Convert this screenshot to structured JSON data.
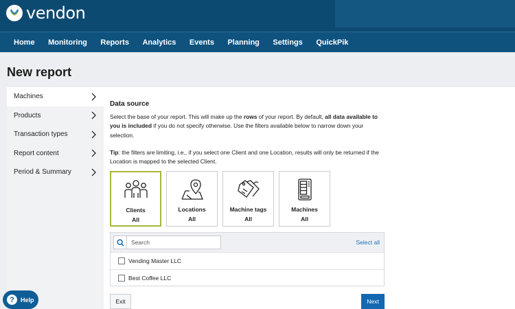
{
  "brand": {
    "name_prefix": "vend",
    "name_suffix": "on",
    "accent": "#a6b73a",
    "header_color": "#0d4a72"
  },
  "nav": {
    "items": [
      "Home",
      "Monitoring",
      "Reports",
      "Analytics",
      "Events",
      "Planning",
      "Settings",
      "QuickPik"
    ]
  },
  "page": {
    "title": "New report"
  },
  "sidebar": {
    "items": [
      {
        "label": "Machines",
        "active": true
      },
      {
        "label": "Products"
      },
      {
        "label": "Transaction types"
      },
      {
        "label": "Report content"
      },
      {
        "label": "Period & Summary"
      }
    ]
  },
  "data_source": {
    "title": "Data source",
    "desc_1": "Select the base of your report. This will make up the ",
    "desc_rows": "rows",
    "desc_2": " of your report. By default, ",
    "desc_bold": "all data available to you is included",
    "desc_3": " if you do not specify otherwise. Use the filters available below to narrow down your selection.",
    "tip_label": "Tip",
    "tip_text": ": the filters are limiting, i.e., if you select one Client and one Location, results will only be returned if the Location is mapped to the selected Client."
  },
  "cards": [
    {
      "name": "Clients",
      "value": "All",
      "icon": "clients-icon",
      "selected": true
    },
    {
      "name": "Locations",
      "value": "All",
      "icon": "location-pin-icon"
    },
    {
      "name": "Machine tags",
      "value": "All",
      "icon": "tags-icon"
    },
    {
      "name": "Machines",
      "value": "All",
      "icon": "vending-machine-icon"
    }
  ],
  "list": {
    "search_placeholder": "Search",
    "select_all": "Select all",
    "rows": [
      "Vending Master LLC",
      "Best Coffee LLC"
    ]
  },
  "buttons": {
    "exit": "Exit",
    "next": "Next"
  },
  "help": {
    "label": "Help",
    "glyph": "?"
  }
}
